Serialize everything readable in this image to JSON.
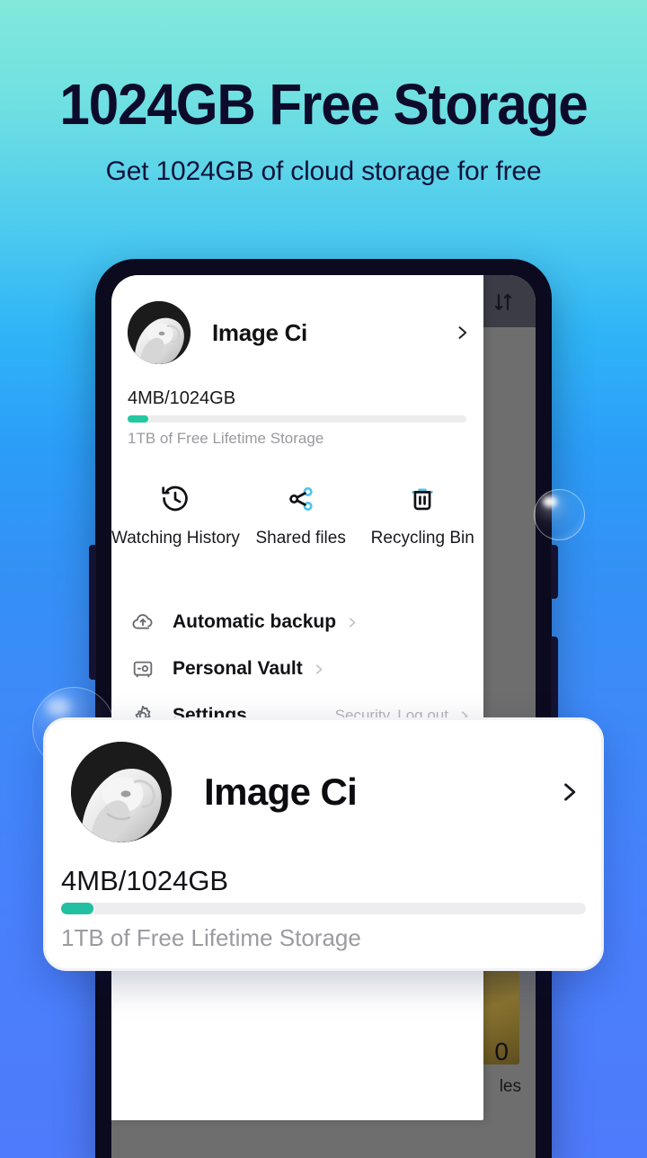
{
  "promo": {
    "headline": "1024GB Free Storage",
    "subheadline": "Get 1024GB of cloud storage for free"
  },
  "colors": {
    "bg_top": "#82E8DA",
    "bg_mid": "#3391F6",
    "bg_bottom": "#4E7BFB",
    "headline_text": "#0D0B2B",
    "progress_fill": "#22BFA0",
    "progress_track": "#EDEDEF",
    "phone_frame": "#0B0A1E",
    "accent_cyan": "#4FC3E8"
  },
  "phone": {
    "status_bar": {
      "sort_icon": "sort-arrows-icon"
    },
    "background_app": {
      "thumbnail_label": "les",
      "thumbnail_count": "0"
    },
    "panel": {
      "profile": {
        "avatar": "marble-statue-avatar",
        "name": "Image Ci",
        "chevron": "chevron-right-icon"
      },
      "storage": {
        "usage": "4MB/1024GB",
        "note": "1TB of Free Lifetime Storage",
        "percent": 6.2
      },
      "quick_actions": [
        {
          "icon": "history-clock-icon",
          "label": "Watching History"
        },
        {
          "icon": "share-nodes-icon",
          "label": "Shared files"
        },
        {
          "icon": "trash-bin-icon",
          "label": "Recycling Bin"
        }
      ],
      "menu": [
        {
          "icon": "cloud-upload-icon",
          "label": "Automatic backup",
          "sub": ""
        },
        {
          "icon": "vault-safe-icon",
          "label": "Personal Vault",
          "sub": ""
        },
        {
          "icon": "gear-icon",
          "label": "Settings",
          "sub": "Security, Log out"
        }
      ]
    }
  },
  "callout": {
    "avatar": "marble-statue-avatar",
    "name": "Image Ci",
    "chevron": "chevron-right-icon",
    "storage_usage": "4MB/1024GB",
    "storage_note": "1TB of Free Lifetime Storage",
    "percent": 6.2
  }
}
